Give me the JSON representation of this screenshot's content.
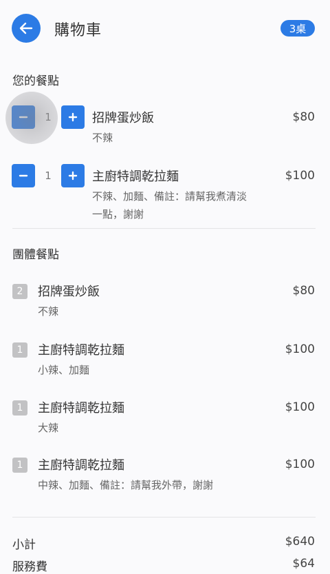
{
  "header": {
    "title": "購物車",
    "table_badge": "3桌"
  },
  "my_section": {
    "title": "您的餐點",
    "items": [
      {
        "qty": "1",
        "name": "招牌蛋炒飯",
        "note_lines": [
          "不辣"
        ],
        "price": "$80"
      },
      {
        "qty": "1",
        "name": "主廚特調乾拉麵",
        "note_lines": [
          "不辣、加麵、備註：請幫我煮清淡",
          "一點，謝謝"
        ],
        "price": "$100"
      }
    ]
  },
  "group_section": {
    "title": "團體餐點",
    "items": [
      {
        "count": "2",
        "name": "招牌蛋炒飯",
        "note": "不辣",
        "price": "$80"
      },
      {
        "count": "1",
        "name": "主廚特調乾拉麵",
        "note": "小辣、加麵",
        "price": "$100"
      },
      {
        "count": "1",
        "name": "主廚特調乾拉麵",
        "note": "大辣",
        "price": "$100"
      },
      {
        "count": "1",
        "name": "主廚特調乾拉麵",
        "note": "中辣、加麵、備註：請幫我外帶，謝謝",
        "price": "$100"
      }
    ]
  },
  "summary": {
    "subtotal_label": "小計",
    "subtotal_value": "$640",
    "service_label": "服務費",
    "service_value": "$64"
  },
  "colors": {
    "accent": "#2c7be5",
    "badge_gray": "#c2c2c4"
  }
}
